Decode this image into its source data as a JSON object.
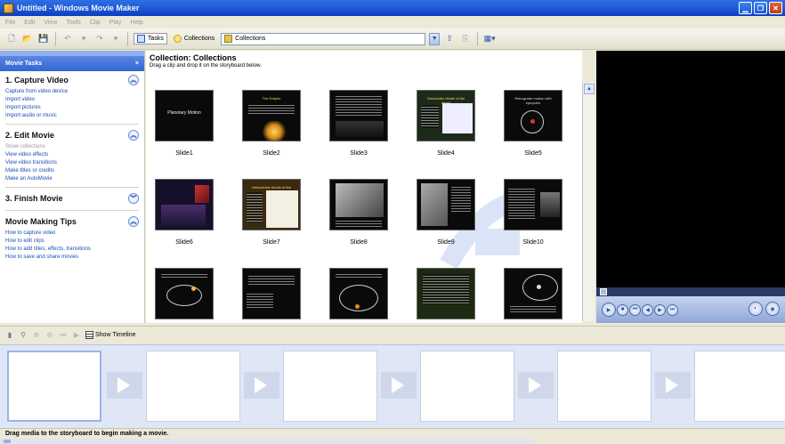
{
  "window": {
    "title": "Untitled - Windows Movie Maker"
  },
  "menu": [
    "File",
    "Edit",
    "View",
    "Tools",
    "Clip",
    "Play",
    "Help"
  ],
  "toolbar": {
    "tasks_label": "Tasks",
    "collections_label": "Collections",
    "collection_select_value": "Collections"
  },
  "taskpane": {
    "header": "Movie Tasks",
    "close_glyph": "×",
    "sections": [
      {
        "title": "1. Capture Video",
        "items": [
          "Capture from video device",
          "Import video",
          "Import pictures",
          "Import audio or music"
        ]
      },
      {
        "title": "2. Edit Movie",
        "items": [
          "Show collections",
          "View video effects",
          "View video transitions",
          "Make titles or credits",
          "Make an AutoMovie"
        ]
      },
      {
        "title": "3. Finish Movie",
        "items": []
      },
      {
        "title": "Movie Making Tips",
        "items": [
          "How to capture video",
          "How to edit clips",
          "How to add titles, effects, transitions",
          "How to save and share movies"
        ]
      }
    ]
  },
  "collection": {
    "title": "Collection: Collections",
    "subtitle": "Drag a clip and drop it on the storyboard below.",
    "clips": [
      "Slide1",
      "Slide2",
      "Slide3",
      "Slide4",
      "Slide5",
      "Slide6",
      "Slide7",
      "Slide8",
      "Slide9",
      "Slide10",
      "",
      "",
      "",
      "",
      ""
    ],
    "thumb_titles": [
      "Planetary Motion",
      "The Ecliptic",
      "",
      "Geocentric Model of the World",
      "Retrograde motion with epicycles",
      "",
      "Heliocentric Model of the World",
      "",
      "",
      "",
      "",
      "",
      "",
      "",
      ""
    ]
  },
  "storyboard_toolbar": {
    "show_timeline_label": "Show Timeline"
  },
  "status": {
    "message": "Drag media to the storyboard to begin making a movie."
  },
  "colors": {
    "titlebar": "#245edb",
    "link": "#1a4db7",
    "storyboard_bg": "#dfe6f5"
  }
}
